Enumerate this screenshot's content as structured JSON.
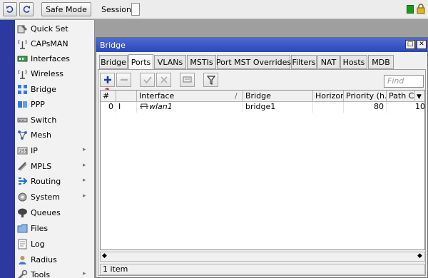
{
  "toolbar": {
    "undo_icon": "undo-icon",
    "redo_icon": "redo-icon",
    "safe_mode_label": "Safe Mode",
    "session_label": "Session:",
    "status_color": "#1a9a1a"
  },
  "sidebar": {
    "items": [
      {
        "label": "Quick Set",
        "icon": "quick-set-icon",
        "submenu": false
      },
      {
        "label": "CAPsMAN",
        "icon": "capsman-icon",
        "submenu": false
      },
      {
        "label": "Interfaces",
        "icon": "interfaces-icon",
        "submenu": false
      },
      {
        "label": "Wireless",
        "icon": "wireless-icon",
        "submenu": false
      },
      {
        "label": "Bridge",
        "icon": "bridge-icon",
        "submenu": false
      },
      {
        "label": "PPP",
        "icon": "ppp-icon",
        "submenu": false
      },
      {
        "label": "Switch",
        "icon": "switch-icon",
        "submenu": false
      },
      {
        "label": "Mesh",
        "icon": "mesh-icon",
        "submenu": false
      },
      {
        "label": "IP",
        "icon": "ip-icon",
        "submenu": true
      },
      {
        "label": "MPLS",
        "icon": "mpls-icon",
        "submenu": true
      },
      {
        "label": "Routing",
        "icon": "routing-icon",
        "submenu": true
      },
      {
        "label": "System",
        "icon": "system-icon",
        "submenu": true
      },
      {
        "label": "Queues",
        "icon": "queues-icon",
        "submenu": false
      },
      {
        "label": "Files",
        "icon": "files-icon",
        "submenu": false
      },
      {
        "label": "Log",
        "icon": "log-icon",
        "submenu": false
      },
      {
        "label": "Radius",
        "icon": "radius-icon",
        "submenu": false
      },
      {
        "label": "Tools",
        "icon": "tools-icon",
        "submenu": true
      }
    ]
  },
  "window": {
    "title": "Bridge",
    "tabs": [
      "Bridge",
      "Ports",
      "VLANs",
      "MSTIs",
      "Port MST Overrides",
      "Filters",
      "NAT",
      "Hosts",
      "MDB"
    ],
    "active_tab": "Ports",
    "find_placeholder": "Find",
    "annotation": "1",
    "columns": [
      "#",
      "",
      "Interface",
      "Bridge",
      "Horizon",
      "Priority (h...",
      "Path Co"
    ],
    "rows": [
      {
        "num": "0",
        "flag": "I",
        "interface": "wlan1",
        "bridge": "bridge1",
        "horizon": "",
        "priority": "80",
        "path_cost": "10"
      }
    ],
    "status": "1 item"
  }
}
